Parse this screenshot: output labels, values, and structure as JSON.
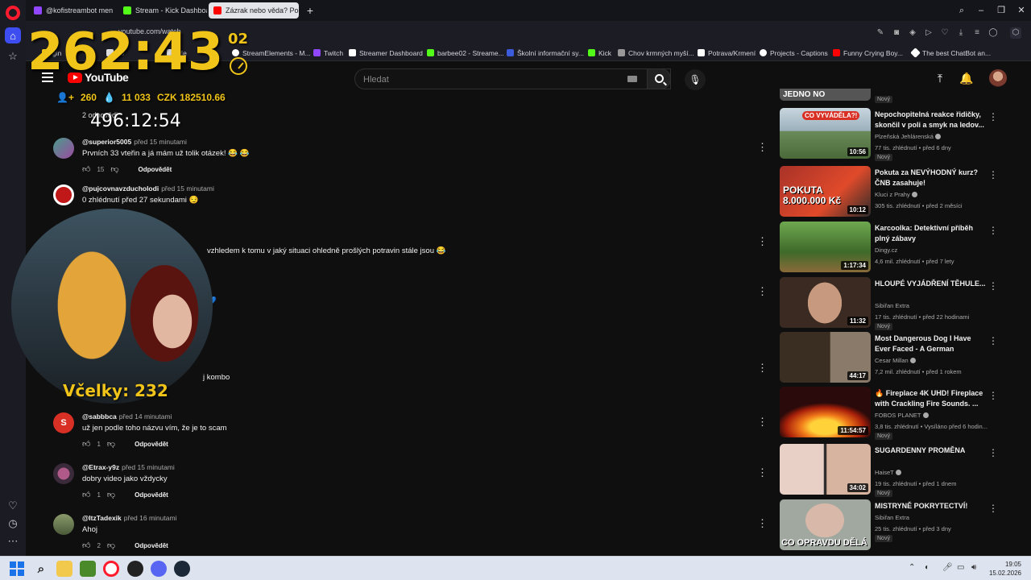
{
  "browser": {
    "tabs": [
      {
        "label": "@kofistreambot men",
        "color": "#9146ff"
      },
      {
        "label": "Stream - Kick Dashboard",
        "color": "#53fc18"
      },
      {
        "label": "Zázrak nebo věda? Podvo",
        "color": "#ff0000"
      }
    ],
    "url": "youtube.com/watch",
    "bookmarks": [
      {
        "label": "gin",
        "color": "#f0c418"
      },
      {
        "label": "bo",
        "color": "#ddd"
      },
      {
        "label": "Me",
        "color": "#ddd"
      },
      {
        "label": "StreamElements - M...",
        "color": "#ffffff"
      },
      {
        "label": "Twitch",
        "color": "#9146ff"
      },
      {
        "label": "Streamer Dashboard",
        "color": "#ffffff"
      },
      {
        "label": "barbee02 - Streame...",
        "color": "#53fc18"
      },
      {
        "label": "Školní informační sy...",
        "color": "#3b5bdb"
      },
      {
        "label": "Kick",
        "color": "#53fc18"
      },
      {
        "label": "Chov krmných myší...",
        "color": "#999"
      },
      {
        "label": "Potrava/Krmení",
        "color": "#ffffff"
      },
      {
        "label": "Projects - Captions",
        "color": "#ffffff"
      },
      {
        "label": "Funny Crying Boy...",
        "color": "#ff0000"
      },
      {
        "label": "The best ChatBot an...",
        "color": "#ffffff"
      }
    ]
  },
  "youtube": {
    "logo": "YouTube",
    "search_placeholder": "Hledat"
  },
  "overlay": {
    "timer_big": "262:43",
    "timer_small": "02",
    "stats_followers": "260",
    "stats_drops": "11 033",
    "stats_czk": "CZK 182510.66",
    "timer_white": "496:12:54",
    "replies": "2 odpovědi",
    "webcam_label": "Včelky:  232"
  },
  "comments": [
    {
      "author": "@superior5005",
      "time": "před 15 minutami",
      "text": "Prvních 33 vteřin a já mám už tolik otázek! 😂 😂",
      "likes": "15",
      "reply": "Odpovědět",
      "avatar": "#4a9c8c"
    },
    {
      "author": "@pujcovnavzducholodi",
      "time": "před 15 minutami",
      "text": "0 zhlédnutí  před 27 sekundami 😏",
      "likes": "",
      "reply": "",
      "avatar": "#c01818"
    },
    {
      "author": "",
      "time": "",
      "text": "vzhledem k tomu v jaký situaci ohledně prošlých potravin stále jsou 😂",
      "likes": "",
      "reply": "",
      "avatar": ""
    },
    {
      "author": "",
      "time": "",
      "text": "💙",
      "likes": "",
      "reply": "",
      "avatar": ""
    },
    {
      "author": "",
      "time": "",
      "text": "j kombo",
      "likes": "",
      "reply": "",
      "avatar": ""
    },
    {
      "author": "@sabbbca",
      "time": "před 14 minutami",
      "text": "už jen podle toho názvu vím, že je to scam",
      "likes": "1",
      "reply": "Odpovědět",
      "avatar": "#d93025",
      "initial": "S"
    },
    {
      "author": "@Etrax-y9z",
      "time": "před 15 minutami",
      "text": "dobry video jako vždycky",
      "likes": "1",
      "reply": "Odpovědět",
      "avatar": "#6a3a5a"
    },
    {
      "author": "@ItzTadexik",
      "time": "před 16 minutami",
      "text": "Ahoj",
      "likes": "2",
      "reply": "Odpovědět",
      "avatar": "#6b7a5a"
    }
  ],
  "related": [
    {
      "title": "",
      "channel": "",
      "meta": "",
      "badge": "Nový",
      "duration": "",
      "thumb": "#444"
    },
    {
      "title": "Nepochopitelná reakce řidičky, skončil v poli a smyk na ledov...",
      "channel": "Plzeňská Jehlárenská",
      "meta": "77 tis. zhlédnutí • před 6 dny",
      "badge": "Nový",
      "duration": "10:56",
      "thumb": "#7f97a6",
      "verified": true
    },
    {
      "title": "Pokuta za NEVÝHODNÝ kurz? ČNB zasahuje!",
      "channel": "Kluci z Prahy",
      "meta": "305 tis. zhlédnutí • před 2 měsíci",
      "badge": "",
      "duration": "10:12",
      "thumb": "#b8322a",
      "verified": true
    },
    {
      "title": "Karcoolka: Detektivní příběh plný zábavy",
      "channel": "Dingy.cz",
      "meta": "4,6 mil. zhlédnutí • před 7 lety",
      "badge": "",
      "duration": "1:17:34",
      "thumb": "#5c8a3a"
    },
    {
      "title": "HLOUPÉ VYJÁDŘENÍ TĚHULE...",
      "channel": "Sibiřan Extra",
      "meta": "17 tis. zhlédnutí • před 22 hodinami",
      "badge": "Nový",
      "duration": "11:32",
      "thumb": "#8e6d5c"
    },
    {
      "title": "Most Dangerous Dog I Have Ever Faced - A German Shepar...",
      "channel": "Cesar Millan",
      "meta": "7,2 mil. zhlédnutí • před 1 rokem",
      "badge": "",
      "duration": "44:17",
      "thumb": "#5a4a3a",
      "verified": true
    },
    {
      "title": "🔥 Fireplace 4K UHD! Fireplace with Crackling Fire Sounds. ...",
      "channel": "FOBOS PLANET",
      "meta": "3,8 tis. zhlédnutí • Vysíláno před 6 hodin...",
      "badge": "Nový",
      "duration": "11:54:57",
      "thumb": "#d9480f",
      "verified": true
    },
    {
      "title": "SUGARDENNY PROMĚNA",
      "channel": "HaiseT",
      "meta": "19 tis. zhlédnutí • před 1 dnem",
      "badge": "Nový",
      "duration": "34:02",
      "thumb": "#c7a08a",
      "verified": true
    },
    {
      "title": "MISTRYNĚ POKRYTECTVÍ!",
      "channel": "Sibiřan Extra",
      "meta": "25 tis. zhlédnutí • před 3 dny",
      "badge": "Nový",
      "duration": "",
      "thumb": "#9aa6a0",
      "overlay_text": "CO OPRAVDU DĚLÁ"
    }
  ],
  "thumb_texts": {
    "t0": "JEDNO NO",
    "t1": "CO VYVÁDĚLA?!",
    "t2": "POKUTA 8.000.000 Kč"
  },
  "taskbar": {
    "time": "19:05",
    "date": "15.02.2026"
  }
}
